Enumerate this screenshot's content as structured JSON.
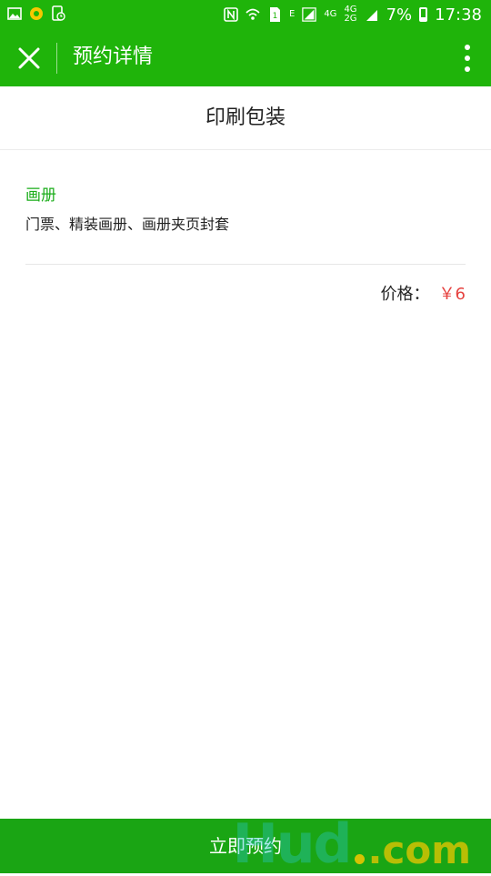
{
  "status_bar": {
    "battery": "7%",
    "time": "17:38",
    "network_e": "E",
    "network_4g": "4G",
    "network_4g_top": "4G",
    "network_2g": "2G"
  },
  "nav": {
    "title": "预约详情"
  },
  "service": {
    "title": "印刷包装",
    "category": "画册",
    "description": "门票、精装画册、画册夹页封套",
    "price_label": "价格：",
    "price_value": "￥6"
  },
  "action": {
    "book_label": "立即预约"
  },
  "watermark": {
    "text": "Hud",
    "suffix": ".com"
  },
  "colors": {
    "brand_green": "#1fb40a",
    "button_green": "#1aa514",
    "category_green": "#1aad19",
    "price_red": "#e64340"
  }
}
